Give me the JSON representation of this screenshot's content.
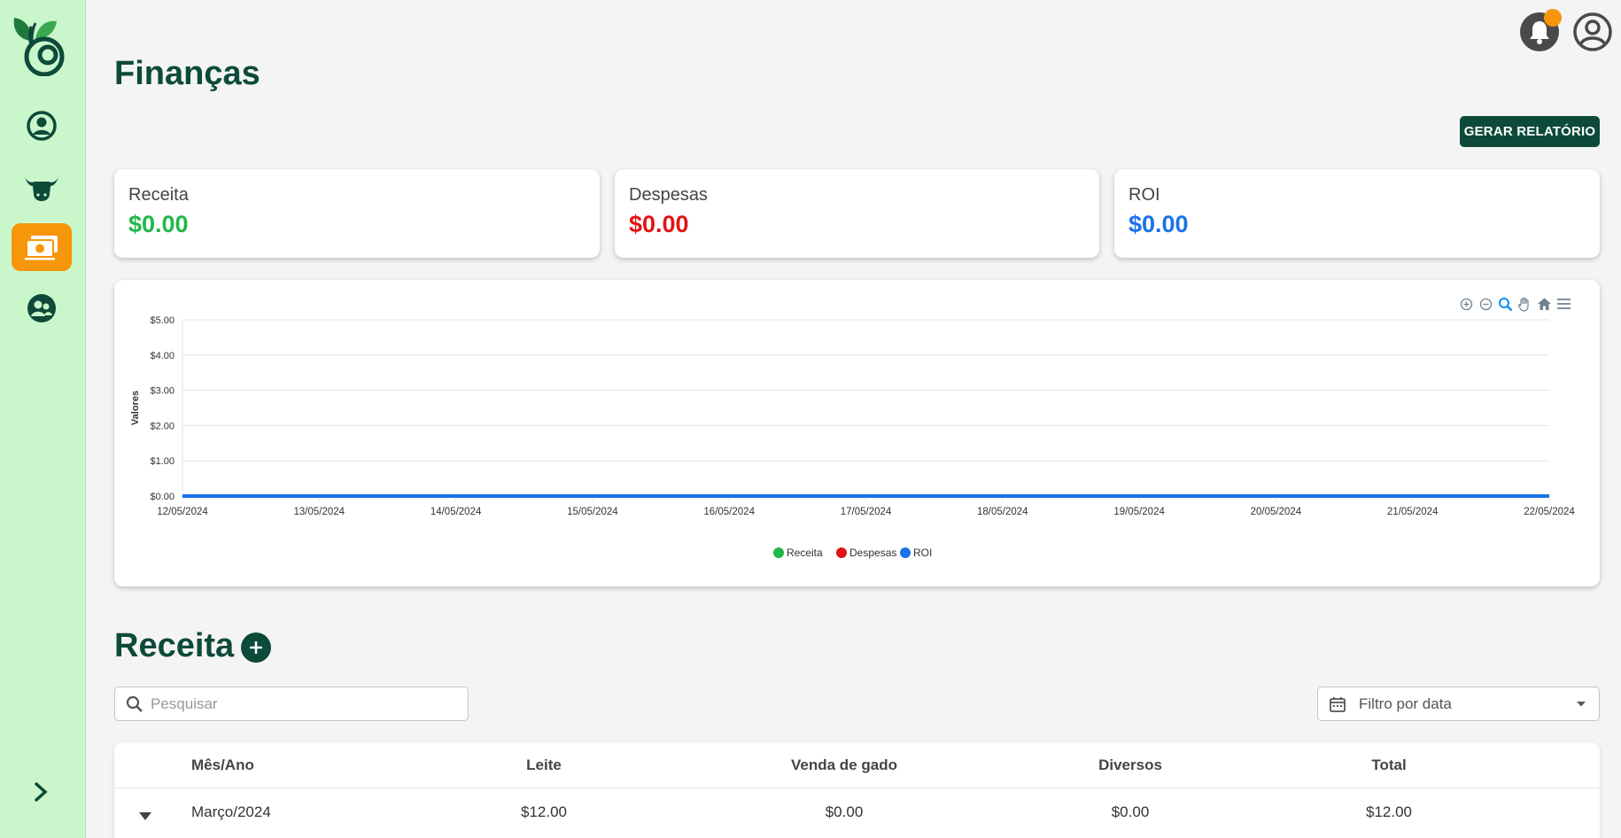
{
  "header": {
    "title": "Finanças",
    "report_button": "GERAR RELATÓRIO"
  },
  "sidebar": {
    "items": [
      {
        "icon": "user-circle-icon"
      },
      {
        "icon": "cattle-icon"
      },
      {
        "icon": "money-icon",
        "active": true
      },
      {
        "icon": "people-icon"
      }
    ],
    "expand_icon": "chevron-right-icon"
  },
  "topbar": {
    "notification_icon": "bell-icon",
    "profile_icon": "user-avatar-icon"
  },
  "cards": [
    {
      "label": "Receita",
      "value": "$0.00",
      "color": "#20b84a"
    },
    {
      "label": "Despesas",
      "value": "$0.00",
      "color": "#e01414"
    },
    {
      "label": "ROI",
      "value": "$0.00",
      "color": "#1a73e8"
    }
  ],
  "chart_data": {
    "type": "line",
    "ylabel": "Valores",
    "xlabel": "",
    "ylim": [
      0,
      5
    ],
    "yticks": [
      "$0.00",
      "$1.00",
      "$2.00",
      "$3.00",
      "$4.00",
      "$5.00"
    ],
    "x": [
      "12/05/2024",
      "13/05/2024",
      "14/05/2024",
      "15/05/2024",
      "16/05/2024",
      "17/05/2024",
      "18/05/2024",
      "19/05/2024",
      "20/05/2024",
      "21/05/2024",
      "22/05/2024"
    ],
    "series": [
      {
        "name": "Receita",
        "color": "#20b84a",
        "values": [
          0,
          0,
          0,
          0,
          0,
          0,
          0,
          0,
          0,
          0,
          0
        ]
      },
      {
        "name": "Despesas",
        "color": "#e01414",
        "values": [
          0,
          0,
          0,
          0,
          0,
          0,
          0,
          0,
          0,
          0,
          0
        ]
      },
      {
        "name": "ROI",
        "color": "#1a73e8",
        "values": [
          0,
          0,
          0,
          0,
          0,
          0,
          0,
          0,
          0,
          0,
          0
        ]
      }
    ],
    "grid": true,
    "legend": "bottom-center"
  },
  "chart_toolbar": [
    "zoom-in-icon",
    "zoom-out-icon",
    "zoom-select-icon",
    "pan-icon",
    "home-icon",
    "menu-icon"
  ],
  "receita_section": {
    "title": "Receita",
    "search_placeholder": "Pesquisar",
    "date_filter": "Filtro por data",
    "columns": [
      "Mês/Ano",
      "Leite",
      "Venda de gado",
      "Diversos",
      "Total"
    ],
    "rows": [
      {
        "mes_ano": "Março/2024",
        "leite": "$12.00",
        "venda_gado": "$0.00",
        "diversos": "$0.00",
        "total": "$12.00"
      }
    ]
  }
}
